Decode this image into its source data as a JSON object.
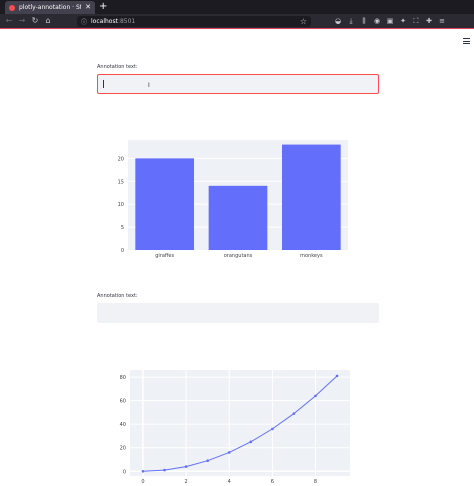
{
  "browser": {
    "tab_title": "plotly-annotation · Stre",
    "new_tab_symbol": "+",
    "url_host": "localhost",
    "url_port": ":8501"
  },
  "form1": {
    "label": "Annotation text:",
    "value": "",
    "placeholder": ""
  },
  "form2": {
    "label": "Annotation text:",
    "value": "",
    "placeholder": ""
  },
  "chart_data": [
    {
      "type": "bar",
      "categories": [
        "giraffes",
        "orangutans",
        "monkeys"
      ],
      "values": [
        20,
        14,
        23
      ],
      "ylim": [
        0,
        24
      ],
      "yticks": [
        0,
        5,
        10,
        15,
        20
      ],
      "color": "#636efa",
      "plot_bg": "#eef1f5"
    },
    {
      "type": "line",
      "x": [
        0,
        1,
        2,
        3,
        4,
        5,
        6,
        7,
        8,
        9
      ],
      "y": [
        0,
        1,
        4,
        9,
        16,
        25,
        36,
        49,
        64,
        81
      ],
      "xlim": [
        -0.6,
        9.6
      ],
      "ylim": [
        -4,
        86
      ],
      "xticks": [
        0,
        2,
        4,
        6,
        8
      ],
      "yticks": [
        0,
        20,
        40,
        60,
        80
      ],
      "color": "#636efa",
      "plot_bg": "#eef1f5"
    }
  ]
}
